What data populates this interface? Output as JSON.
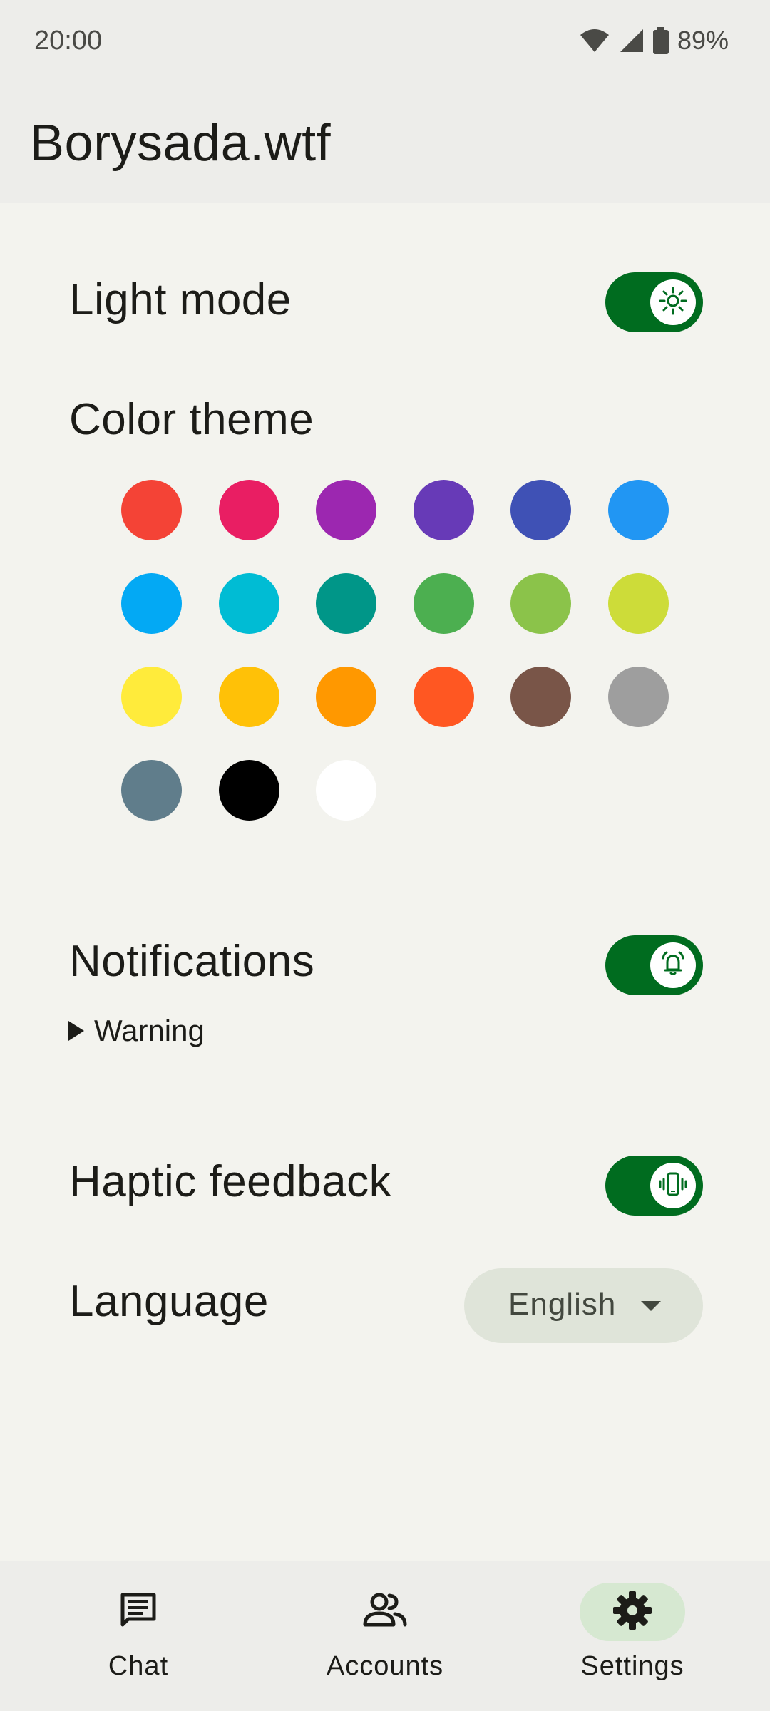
{
  "status_bar": {
    "time": "20:00",
    "battery": "89%",
    "icons": [
      "wifi-icon",
      "signal-icon",
      "battery-icon"
    ]
  },
  "app_bar": {
    "title": "Borysada.wtf"
  },
  "settings": {
    "light_mode": {
      "label": "Light mode",
      "enabled": true,
      "icon": "sun-icon"
    },
    "color_theme": {
      "label": "Color theme",
      "colors": [
        "#f44336",
        "#e91e63",
        "#9c27b0",
        "#673ab7",
        "#3f51b5",
        "#2196f3",
        "#03a9f4",
        "#00bcd4",
        "#009688",
        "#4caf50",
        "#8bc34a",
        "#cddc39",
        "#ffeb3b",
        "#ffc107",
        "#ff9800",
        "#ff5722",
        "#795548",
        "#9e9e9e",
        "#607d8b",
        "#000000",
        "#ffffff"
      ]
    },
    "notifications": {
      "label": "Notifications",
      "enabled": true,
      "icon": "alarm-bell-icon",
      "warning_label": "Warning"
    },
    "haptic_feedback": {
      "label": "Haptic feedback",
      "enabled": true,
      "icon": "vibrate-phone-icon"
    },
    "language": {
      "label": "Language",
      "selected": "English"
    }
  },
  "bottom_nav": {
    "items": [
      {
        "label": "Chat",
        "icon": "chat-icon",
        "active": false
      },
      {
        "label": "Accounts",
        "icon": "accounts-icon",
        "active": false
      },
      {
        "label": "Settings",
        "icon": "gear-icon",
        "active": true
      }
    ]
  },
  "theme": {
    "accent": "#006c1f",
    "nav_active_bg": "#d6e8d1",
    "select_bg": "#dfe4d9"
  }
}
